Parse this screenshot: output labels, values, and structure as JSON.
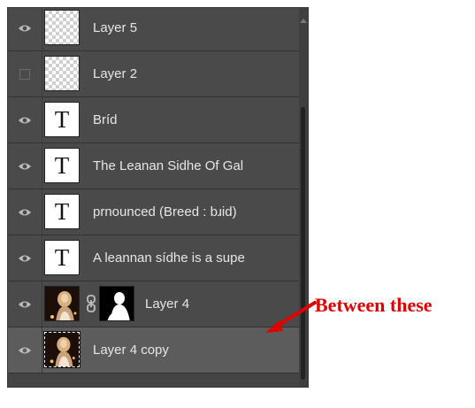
{
  "layers_panel": {
    "layers": [
      {
        "name": "Layer 5",
        "visible": true,
        "thumbnail": "transparent",
        "selected": false
      },
      {
        "name": "Layer 2",
        "visible": false,
        "thumbnail": "transparent",
        "selected": false
      },
      {
        "name": "Bríd",
        "visible": true,
        "thumbnail": "text",
        "thumb_glyph": "T",
        "selected": false
      },
      {
        "name": "The Leanan Sidhe Of Gal",
        "visible": true,
        "thumbnail": "text",
        "thumb_glyph": "T",
        "selected": false
      },
      {
        "name": "prnounced (Breed : bɹid)",
        "visible": true,
        "thumbnail": "text",
        "thumb_glyph": "T",
        "selected": false
      },
      {
        "name": "A leannan sídhe is a supe",
        "visible": true,
        "thumbnail": "text",
        "thumb_glyph": "T",
        "selected": false
      },
      {
        "name": "Layer 4",
        "visible": true,
        "thumbnail": "photo",
        "has_mask": true,
        "linked": true,
        "selected": false
      },
      {
        "name": "Layer 4 copy",
        "visible": true,
        "thumbnail": "photo",
        "selected": true
      }
    ],
    "icons": {
      "visibility": "eye-icon",
      "hidden": "hidden-box-icon",
      "link": "chain-link-icon"
    },
    "colors": {
      "panel_bg": "#4a4a4a",
      "selected_bg": "#5c5c5c",
      "text": "#e6e6e6"
    }
  },
  "annotation": {
    "text": "Between these",
    "color": "#e00000",
    "icon": "red-arrow-icon"
  }
}
